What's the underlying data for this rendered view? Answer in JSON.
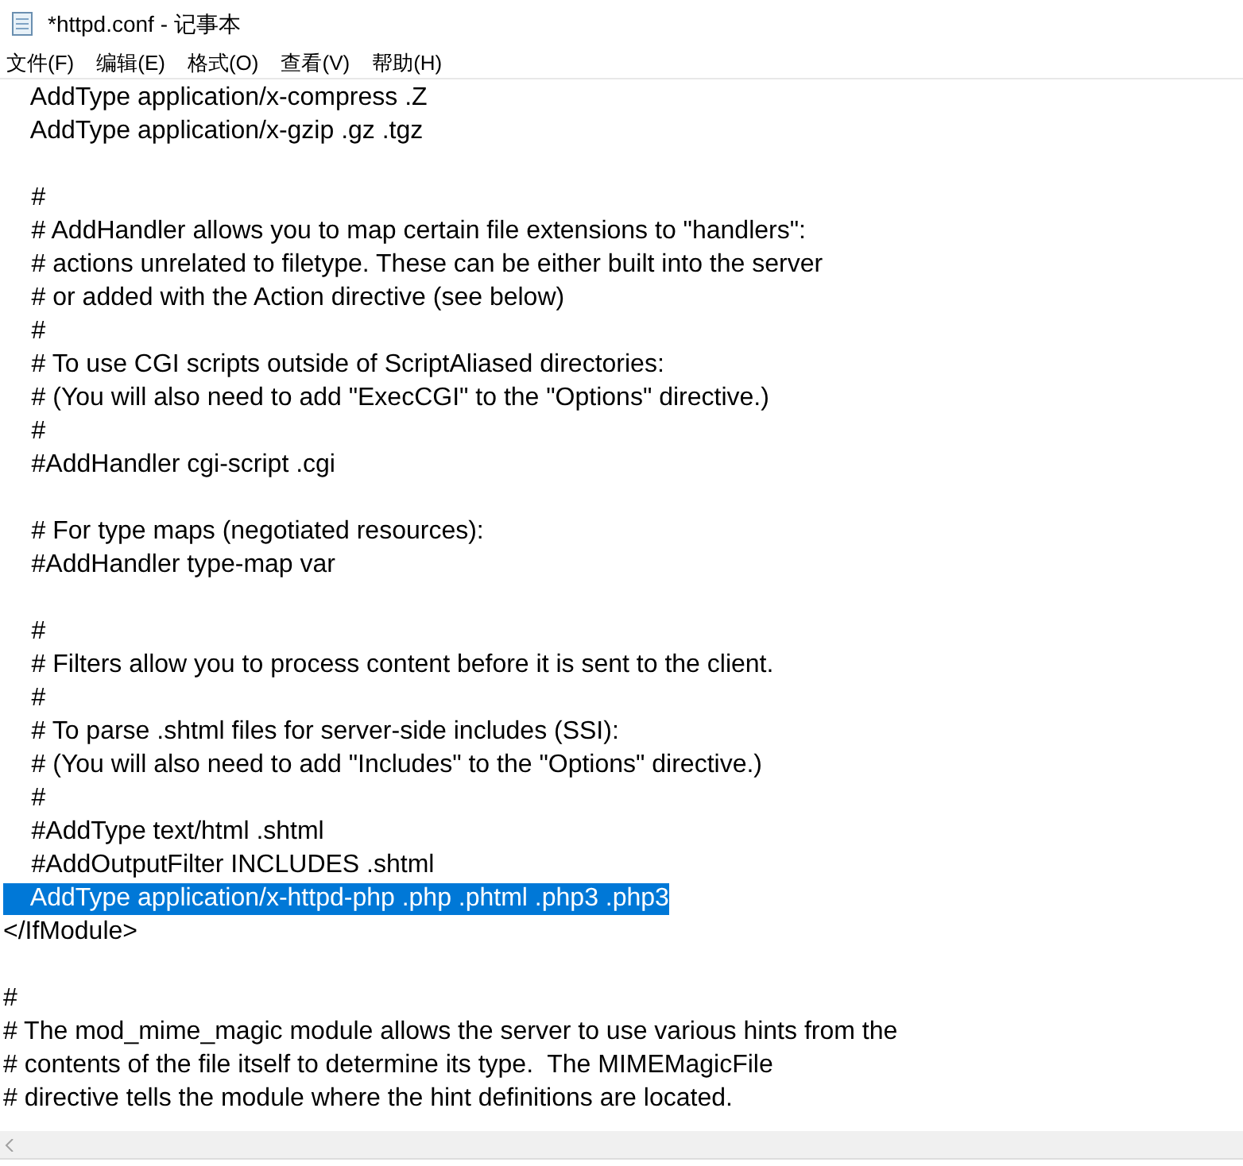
{
  "window": {
    "title": "*httpd.conf - 记事本"
  },
  "menu": [
    "文件(F)",
    "编辑(E)",
    "格式(O)",
    "查看(V)",
    "帮助(H)"
  ],
  "lines": [
    {
      "kind": "text",
      "text": "    AddType application/x-compress .Z",
      "selected": false
    },
    {
      "kind": "text",
      "text": "    AddType application/x-gzip .gz .tgz",
      "selected": false
    },
    {
      "kind": "blank",
      "selected": false
    },
    {
      "kind": "text",
      "text": "    #",
      "selected": false
    },
    {
      "kind": "text",
      "text": "    # AddHandler allows you to map certain file extensions to \"handlers\":",
      "selected": false
    },
    {
      "kind": "text",
      "text": "    # actions unrelated to filetype. These can be either built into the server",
      "selected": false
    },
    {
      "kind": "text",
      "text": "    # or added with the Action directive (see below)",
      "selected": false
    },
    {
      "kind": "text",
      "text": "    #",
      "selected": false
    },
    {
      "kind": "text",
      "text": "    # To use CGI scripts outside of ScriptAliased directories:",
      "selected": false
    },
    {
      "kind": "text",
      "text": "    # (You will also need to add \"ExecCGI\" to the \"Options\" directive.)",
      "selected": false
    },
    {
      "kind": "text",
      "text": "    #",
      "selected": false
    },
    {
      "kind": "text",
      "text": "    #AddHandler cgi-script .cgi",
      "selected": false
    },
    {
      "kind": "blank",
      "selected": false
    },
    {
      "kind": "text",
      "text": "    # For type maps (negotiated resources):",
      "selected": false
    },
    {
      "kind": "text",
      "text": "    #AddHandler type-map var",
      "selected": false
    },
    {
      "kind": "blank",
      "selected": false
    },
    {
      "kind": "text",
      "text": "    #",
      "selected": false
    },
    {
      "kind": "text",
      "text": "    # Filters allow you to process content before it is sent to the client.",
      "selected": false
    },
    {
      "kind": "text",
      "text": "    #",
      "selected": false
    },
    {
      "kind": "text",
      "text": "    # To parse .shtml files for server-side includes (SSI):",
      "selected": false
    },
    {
      "kind": "text",
      "text": "    # (You will also need to add \"Includes\" to the \"Options\" directive.)",
      "selected": false
    },
    {
      "kind": "text",
      "text": "    #",
      "selected": false
    },
    {
      "kind": "text",
      "text": "    #AddType text/html .shtml",
      "selected": false
    },
    {
      "kind": "text",
      "text": "    #AddOutputFilter INCLUDES .shtml",
      "selected": false
    },
    {
      "kind": "text",
      "text": "    AddType application/x-httpd-php .php .phtml .php3 .php3",
      "selected": true
    },
    {
      "kind": "text",
      "text": "</IfModule>",
      "selected": false
    },
    {
      "kind": "blank",
      "selected": false
    },
    {
      "kind": "text",
      "text": "#",
      "selected": false
    },
    {
      "kind": "text",
      "text": "# The mod_mime_magic module allows the server to use various hints from the",
      "selected": false
    },
    {
      "kind": "text",
      "text": "# contents of the file itself to determine its type.  The MIMEMagicFile",
      "selected": false
    },
    {
      "kind": "text",
      "text": "# directive tells the module where the hint definitions are located.",
      "selected": false
    }
  ]
}
